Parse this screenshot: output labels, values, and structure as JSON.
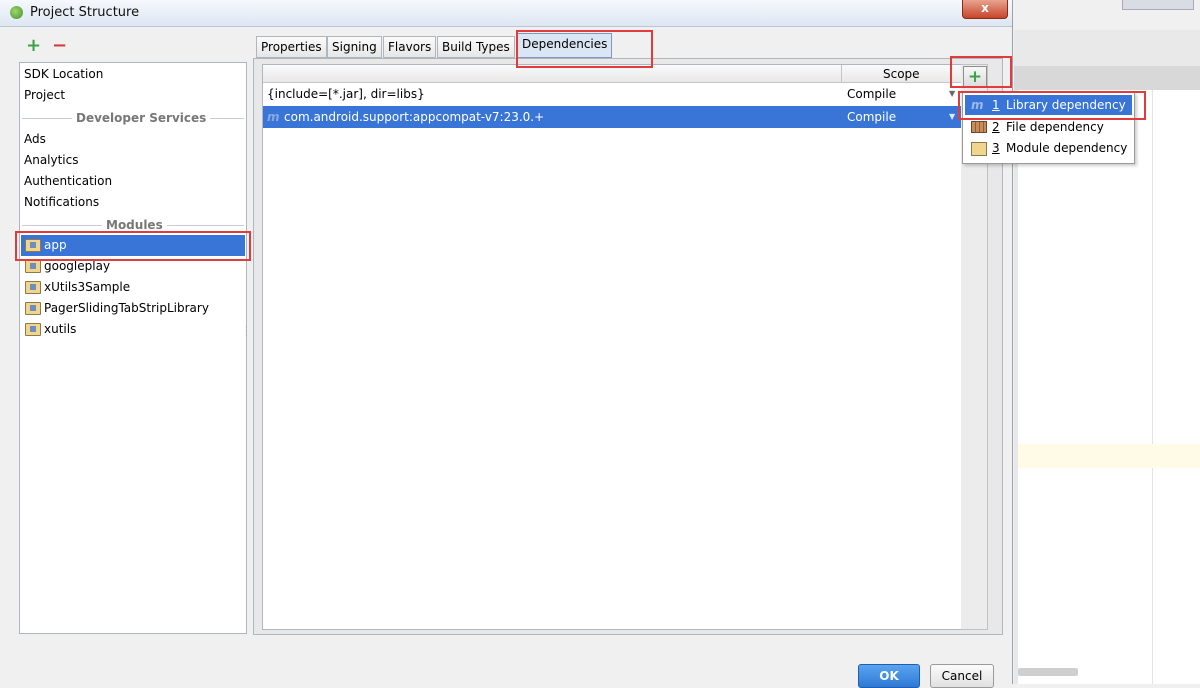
{
  "window": {
    "title": "Project Structure",
    "close_label": "x"
  },
  "sidebar": {
    "add_label": "+",
    "remove_label": "−",
    "top_items": [
      "SDK Location",
      "Project"
    ],
    "developer_services_header": "Developer Services",
    "developer_services": [
      "Ads",
      "Analytics",
      "Authentication",
      "Notifications"
    ],
    "modules_header": "Modules",
    "modules": [
      "app",
      "googleplay",
      "xUtils3Sample",
      "PagerSlidingTabStripLibrary",
      "xutils"
    ],
    "selected_module": "app"
  },
  "tabs": [
    "Properties",
    "Signing",
    "Flavors",
    "Build Types",
    "Dependencies"
  ],
  "active_tab": "Dependencies",
  "dependencies": {
    "scope_header": "Scope",
    "rows": [
      {
        "name": "{include=[*.jar], dir=libs}",
        "scope": "Compile"
      },
      {
        "name": "com.android.support:appcompat-v7:23.0.+",
        "scope": "Compile"
      }
    ],
    "add_label": "+"
  },
  "add_menu": {
    "items": [
      {
        "num": "1",
        "label": "Library dependency",
        "icon": "library-icon"
      },
      {
        "num": "2",
        "label": "File dependency",
        "icon": "jar-file-icon"
      },
      {
        "num": "3",
        "label": "Module dependency",
        "icon": "module-icon"
      }
    ]
  },
  "buttons": {
    "ok": "OK",
    "cancel": "Cancel"
  },
  "colors": {
    "selection": "#3875d7",
    "annotation": "#e23b3b",
    "add_green": "#3aa34a",
    "remove_red": "#d23b3b"
  }
}
